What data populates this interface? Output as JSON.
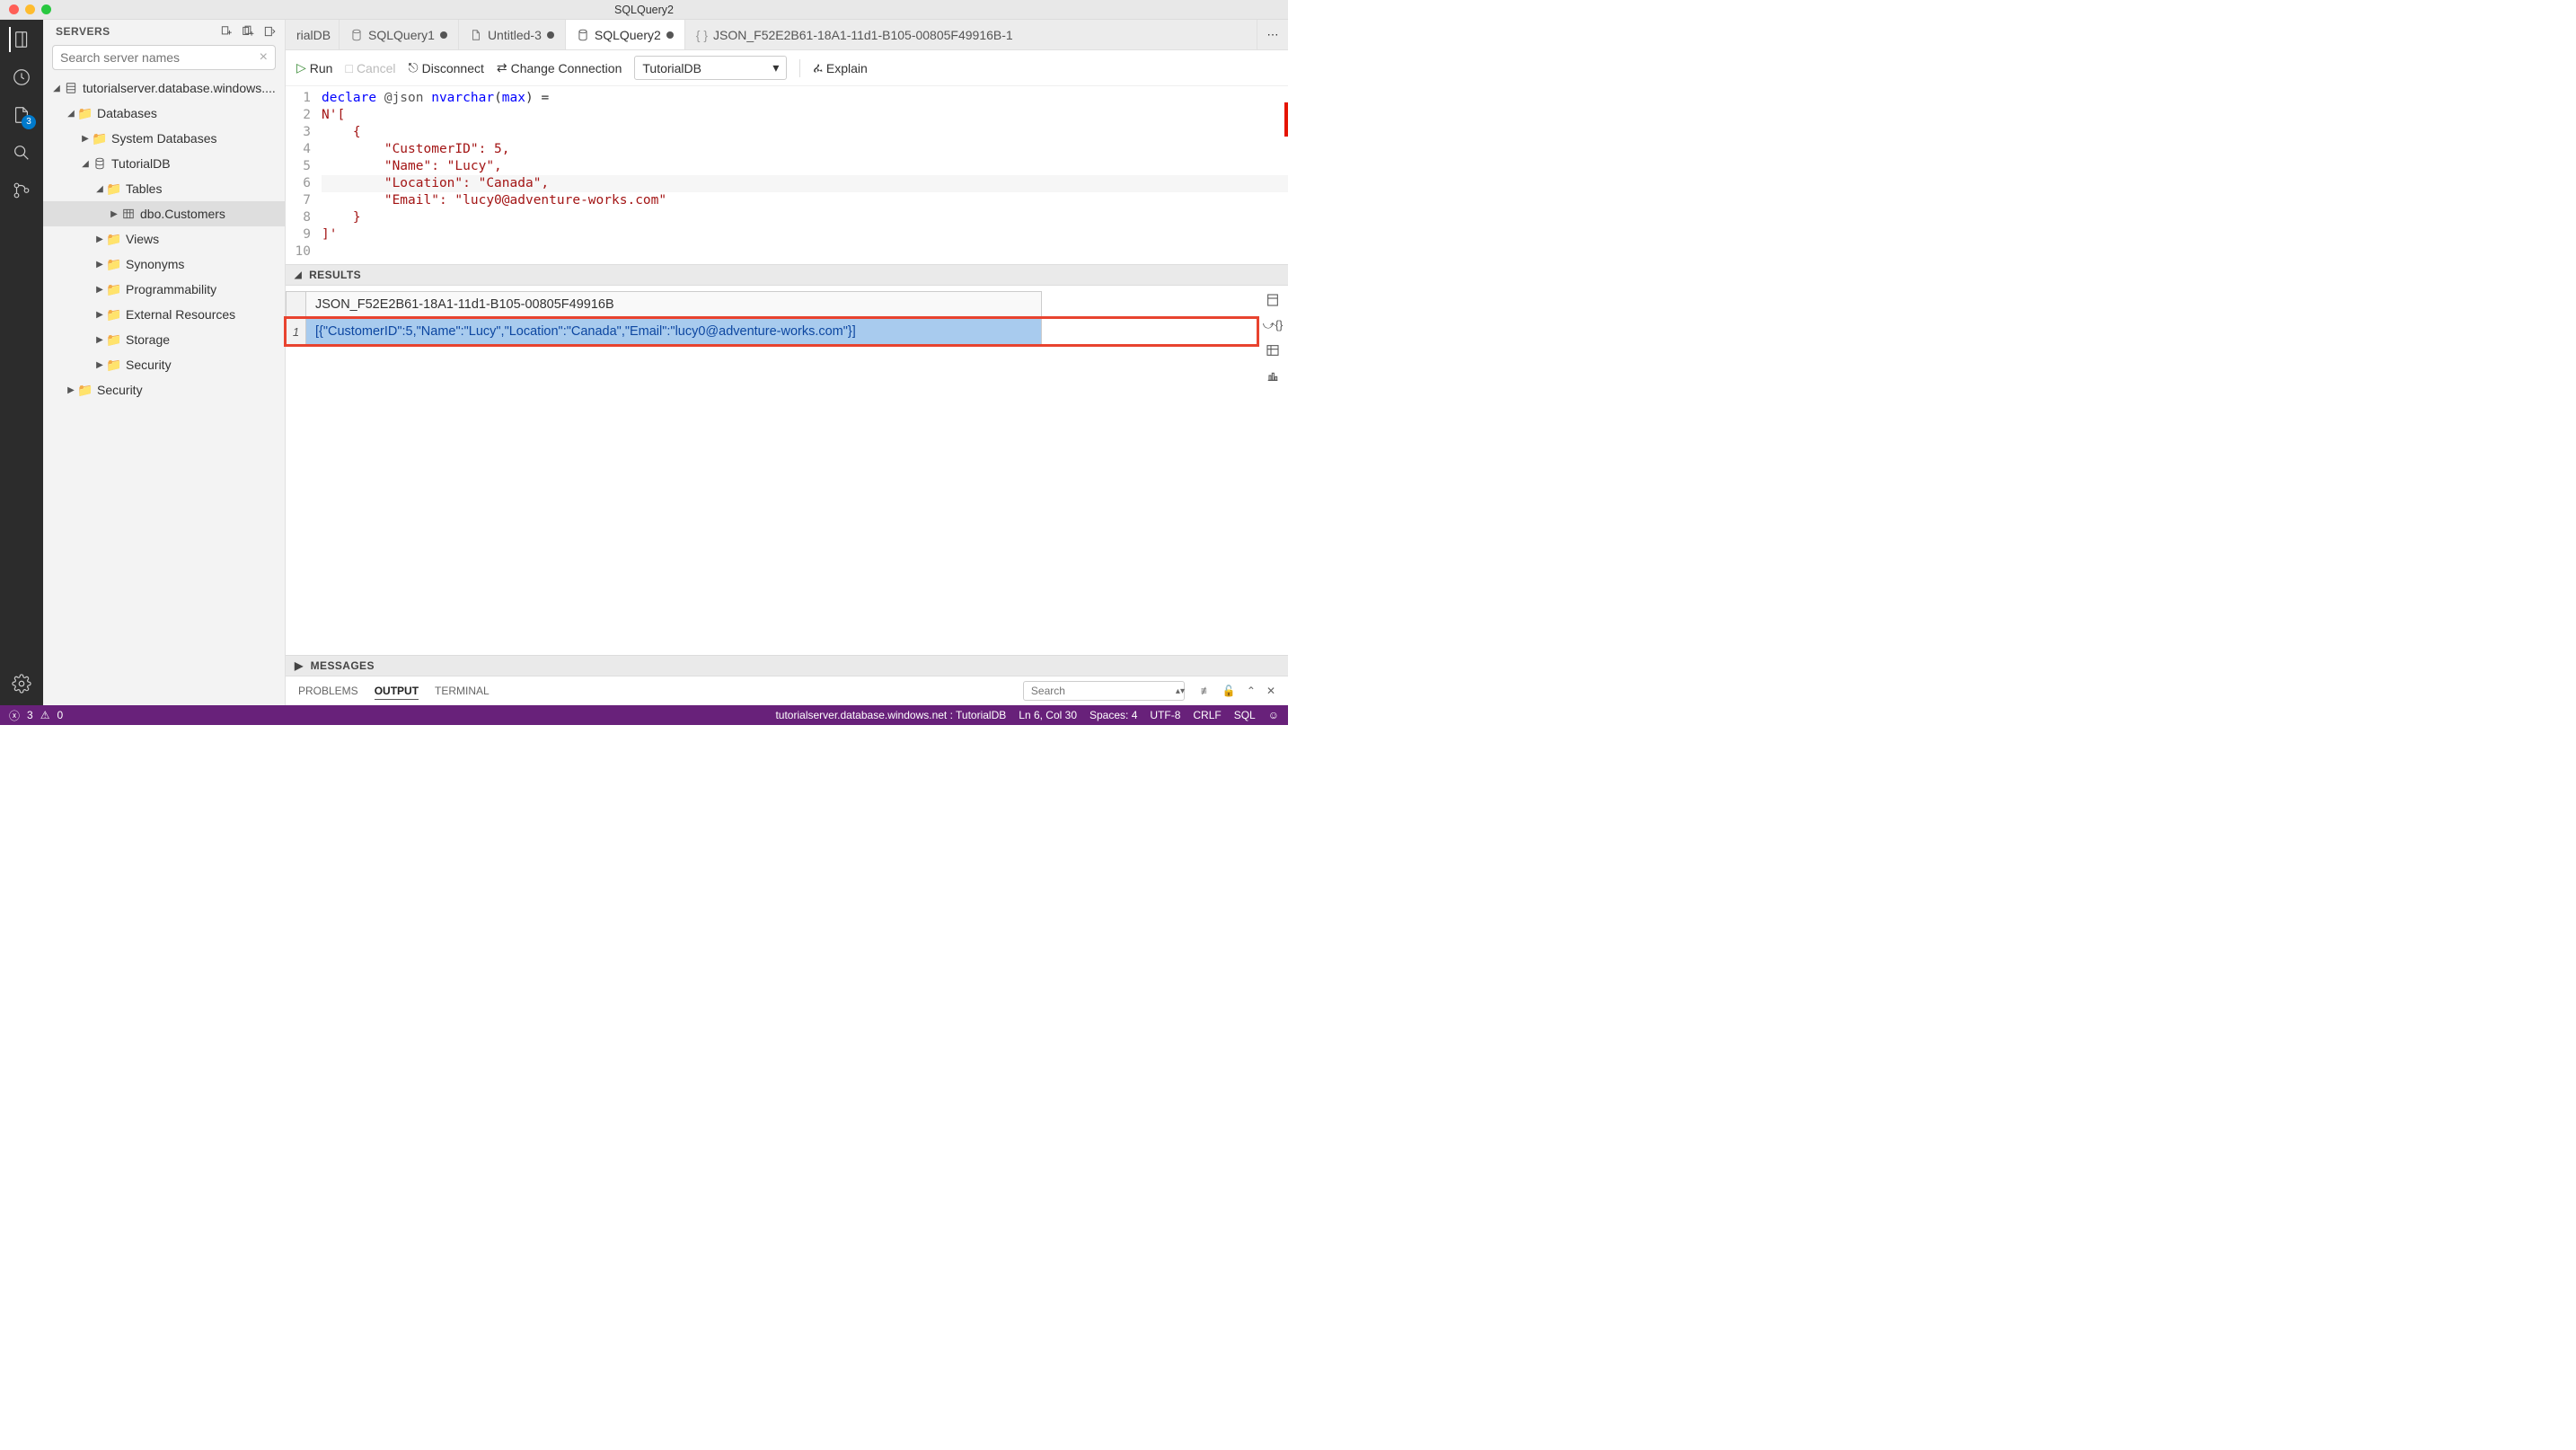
{
  "window": {
    "title": "SQLQuery2"
  },
  "activitybar": {
    "badge_changes": "3"
  },
  "sidebar": {
    "title": "SERVERS",
    "search_placeholder": "Search server names",
    "tree": {
      "server": "tutorialserver.database.windows....",
      "databases": "Databases",
      "sysdb": "System Databases",
      "tutdb": "TutorialDB",
      "tables": "Tables",
      "dbo_customers": "dbo.Customers",
      "views": "Views",
      "synonyms": "Synonyms",
      "programmability": "Programmability",
      "external": "External Resources",
      "storage": "Storage",
      "db_security": "Security",
      "server_security": "Security"
    }
  },
  "tabs": {
    "t0": "rialDB",
    "t1": "SQLQuery1",
    "t2": "Untitled-3",
    "t3": "SQLQuery2",
    "t4": "JSON_F52E2B61-18A1-11d1-B105-00805F49916B-1"
  },
  "toolbar": {
    "run": "Run",
    "cancel": "Cancel",
    "disconnect": "Disconnect",
    "change_conn": "Change Connection",
    "database": "TutorialDB",
    "explain": "Explain"
  },
  "code": {
    "l1a": "declare",
    "l1b": " @json ",
    "l1c": "nvarchar",
    "l1d": "(",
    "l1e": "max",
    "l1f": ") =",
    "l2": "N'[",
    "l3": "    {",
    "l4": "        \"CustomerID\": 5,",
    "l5": "        \"Name\": \"Lucy\",",
    "l6": "        \"Location\": \"Canada\",",
    "l7": "        \"Email\": \"lucy0@adventure-works.com\"",
    "l8": "    }",
    "l9": "]'",
    "ln": [
      "1",
      "2",
      "3",
      "4",
      "5",
      "6",
      "7",
      "8",
      "9",
      "10"
    ]
  },
  "results": {
    "header": "RESULTS",
    "col": "JSON_F52E2B61-18A1-11d1-B105-00805F49916B",
    "rownum": "1",
    "value": "[{\"CustomerID\":5,\"Name\":\"Lucy\",\"Location\":\"Canada\",\"Email\":\"lucy0@adventure-works.com\"}]"
  },
  "messages": {
    "header": "MESSAGES"
  },
  "bottom": {
    "problems": "PROBLEMS",
    "output": "OUTPUT",
    "terminal": "TERMINAL",
    "search_placeholder": "Search"
  },
  "statusbar": {
    "errors": "3",
    "warnings": "0",
    "connection": "tutorialserver.database.windows.net : TutorialDB",
    "cursor": "Ln 6, Col 30",
    "spaces": "Spaces: 4",
    "encoding": "UTF-8",
    "eol": "CRLF",
    "lang": "SQL"
  }
}
